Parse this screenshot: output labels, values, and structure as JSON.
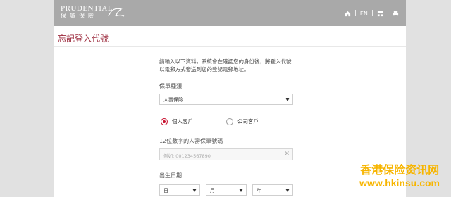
{
  "header": {
    "logo_en": "PRUDENTIAL",
    "logo_cn": "保誠保險",
    "lang": "EN"
  },
  "page": {
    "title": "忘記登入代號"
  },
  "form": {
    "intro": "請輸入以下資料，系統會在確認您的身份後，將登入代號以電郵方式發送到您的登記電郵地址。",
    "policy_type_label": "保單種類",
    "policy_type_value": "人壽保險",
    "radio_personal": "個人客戶",
    "radio_company": "公司客戶",
    "policy_number_label": "12位數字的人壽保單號碼",
    "policy_number_placeholder": "例如: 001234567890",
    "dob_label": "出生日期",
    "dob_day": "日",
    "dob_month": "月",
    "dob_year": "年"
  },
  "watermark": {
    "cn": "香港保险资讯网",
    "url": "www.hkinsu.com"
  }
}
